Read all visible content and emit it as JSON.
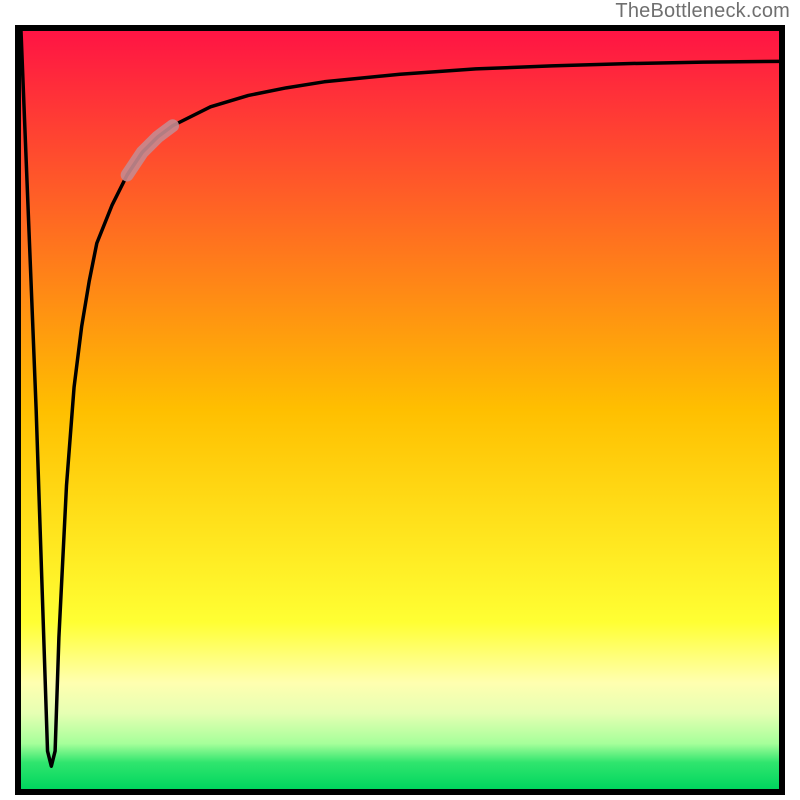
{
  "watermark": "TheBottleneck.com",
  "colors": {
    "frame_border": "#000000",
    "curve": "#000000",
    "highlight": "#c7898f",
    "gradient_stops": [
      {
        "offset": 0.0,
        "color": "#ff1444"
      },
      {
        "offset": 0.5,
        "color": "#ffbf00"
      },
      {
        "offset": 0.78,
        "color": "#ffff33"
      },
      {
        "offset": 0.86,
        "color": "#ffffb0"
      },
      {
        "offset": 0.9,
        "color": "#e6ffb3"
      },
      {
        "offset": 0.94,
        "color": "#a6ff9a"
      },
      {
        "offset": 0.965,
        "color": "#30e56e"
      },
      {
        "offset": 1.0,
        "color": "#00d65e"
      }
    ]
  },
  "chart_data": {
    "type": "line",
    "title": "",
    "xlabel": "",
    "ylabel": "",
    "xlim": [
      0,
      100
    ],
    "ylim": [
      0,
      100
    ],
    "series": [
      {
        "name": "curve",
        "x": [
          0,
          1,
          2,
          3,
          3.5,
          4,
          4.5,
          5,
          6,
          7,
          8,
          9,
          10,
          12,
          14,
          16,
          18,
          20,
          25,
          30,
          35,
          40,
          50,
          60,
          70,
          80,
          90,
          100
        ],
        "y": [
          100,
          75,
          50,
          20,
          5,
          3,
          5,
          20,
          40,
          53,
          61,
          67,
          72,
          77,
          81,
          84,
          86,
          87.5,
          90,
          91.5,
          92.5,
          93.3,
          94.3,
          95,
          95.4,
          95.7,
          95.9,
          96
        ]
      }
    ],
    "highlight_segment": {
      "x_start": 14,
      "x_end": 20
    }
  }
}
